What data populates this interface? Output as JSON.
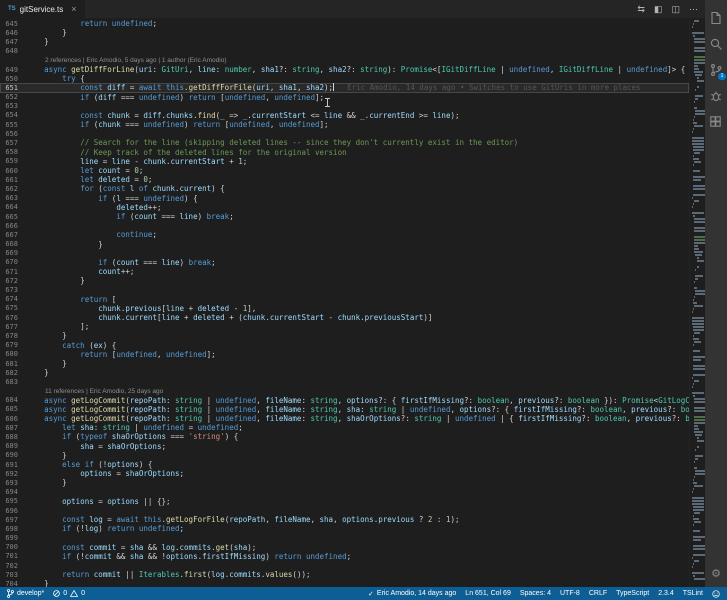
{
  "colors": {
    "accent": "#007acc",
    "status_bar_bg": "#0d5e94",
    "editor_bg": "#1e1e1e",
    "activity_bar_bg": "#333333",
    "keyword": "#569cd6",
    "type": "#4ec9b0",
    "function": "#dcdcaa",
    "variable": "#9cdcfe",
    "string": "#ce9178",
    "comment": "#6a9955",
    "number": "#b5cea8"
  },
  "tab_bar": {
    "active_tab": {
      "file_icon": "TS",
      "label": "gitService.ts",
      "close_glyph": "×"
    },
    "actions": [
      {
        "name": "open-changes",
        "glyph": "⇆"
      },
      {
        "name": "split-editor",
        "glyph": "◧"
      },
      {
        "name": "toggle-layout",
        "glyph": "◫"
      },
      {
        "name": "more-actions",
        "glyph": "⋯"
      }
    ]
  },
  "activity_bar": {
    "items": [
      {
        "name": "explorer"
      },
      {
        "name": "search"
      },
      {
        "name": "source-control",
        "badge": "1"
      },
      {
        "name": "debug"
      },
      {
        "name": "extensions"
      }
    ],
    "bottom": [
      {
        "name": "settings",
        "glyph": "⚙"
      }
    ]
  },
  "editor": {
    "lines": [
      {
        "n": 645,
        "code": "            return undefined;"
      },
      {
        "n": 646,
        "code": "        }"
      },
      {
        "n": 647,
        "code": "    }"
      },
      {
        "n": 648,
        "code": ""
      },
      {
        "lens": "2 references | Eric Amodio, 5 days ago | 1 author (Eric Amodio)"
      },
      {
        "n": 649,
        "code": "    async getDiffForLine(uri: GitUri, line: number, sha1?: string, sha2?: string): Promise<[IGitDiffLine | undefined, IGitDiffLine | undefined]> {"
      },
      {
        "n": 650,
        "code": "        try {"
      },
      {
        "n": 651,
        "code": "            const diff = await this.getDiffForFile(uri, sha1, sha2);",
        "current": true,
        "cursor": true,
        "blame": "Eric Amodio, 14 days ago • Switches to use GitUris in more places"
      },
      {
        "n": 652,
        "code": "            if (diff === undefined) return [undefined, undefined];"
      },
      {
        "n": 653,
        "code": ""
      },
      {
        "n": 654,
        "code": "            const chunk = diff.chunks.find(_ => _.currentStart <= line && _.currentEnd >= line);"
      },
      {
        "n": 655,
        "code": "            if (chunk === undefined) return [undefined, undefined];"
      },
      {
        "n": 656,
        "code": ""
      },
      {
        "n": 657,
        "code": "            // Search for the line (skipping deleted lines -- since they don't currently exist in the editor)"
      },
      {
        "n": 658,
        "code": "            // Keep track of the deleted lines for the original version"
      },
      {
        "n": 659,
        "code": "            line = line - chunk.currentStart + 1;"
      },
      {
        "n": 660,
        "code": "            let count = 0;"
      },
      {
        "n": 661,
        "code": "            let deleted = 0;"
      },
      {
        "n": 662,
        "code": "            for (const l of chunk.current) {"
      },
      {
        "n": 663,
        "code": "                if (l === undefined) {"
      },
      {
        "n": 664,
        "code": "                    deleted++;"
      },
      {
        "n": 665,
        "code": "                    if (count === line) break;"
      },
      {
        "n": 666,
        "code": ""
      },
      {
        "n": 667,
        "code": "                    continue;"
      },
      {
        "n": 668,
        "code": "                }"
      },
      {
        "n": 669,
        "code": ""
      },
      {
        "n": 670,
        "code": "                if (count === line) break;"
      },
      {
        "n": 671,
        "code": "                count++;"
      },
      {
        "n": 672,
        "code": "            }"
      },
      {
        "n": 673,
        "code": ""
      },
      {
        "n": 674,
        "code": "            return ["
      },
      {
        "n": 675,
        "code": "                chunk.previous[line + deleted - 1],"
      },
      {
        "n": 676,
        "code": "                chunk.current[line + deleted + (chunk.currentStart - chunk.previousStart)]"
      },
      {
        "n": 677,
        "code": "            ];"
      },
      {
        "n": 678,
        "code": "        }"
      },
      {
        "n": 679,
        "code": "        catch (ex) {"
      },
      {
        "n": 680,
        "code": "            return [undefined, undefined];"
      },
      {
        "n": 681,
        "code": "        }"
      },
      {
        "n": 682,
        "code": "    }"
      },
      {
        "n": 683,
        "code": ""
      },
      {
        "lens": "11 references | Eric Amodio, 25 days ago"
      },
      {
        "n": 684,
        "code": "    async getLogCommit(repoPath: string | undefined, fileName: string, options?: { firstIfMissing?: boolean, previous?: boolean }): Promise<GitLogCommit | undefined>;"
      },
      {
        "n": 685,
        "code": "    async getLogCommit(repoPath: string | undefined, fileName: string, sha: string | undefined, options?: { firstIfMissing?: boolean, previous?: boolean }): Promise<GitLogCommit | undefined>;"
      },
      {
        "n": 686,
        "code": "    async getLogCommit(repoPath: string | undefined, fileName: string, shaOrOptions?: string | undefined | { firstIfMissing?: boolean, previous?: boolean }, options?: { firstIfMissing?: boolean, previous?: boolean }): Promise<GitLogCommit | undefined> {"
      },
      {
        "n": 687,
        "code": "        let sha: string | undefined = undefined;"
      },
      {
        "n": 688,
        "code": "        if (typeof shaOrOptions === 'string') {"
      },
      {
        "n": 689,
        "code": "            sha = shaOrOptions;"
      },
      {
        "n": 690,
        "code": "        }"
      },
      {
        "n": 691,
        "code": "        else if (!options) {"
      },
      {
        "n": 692,
        "code": "            options = shaOrOptions;"
      },
      {
        "n": 693,
        "code": "        }"
      },
      {
        "n": 694,
        "code": ""
      },
      {
        "n": 695,
        "code": "        options = options || {};"
      },
      {
        "n": 696,
        "code": ""
      },
      {
        "n": 697,
        "code": "        const log = await this.getLogForFile(repoPath, fileName, sha, options.previous ? 2 : 1);"
      },
      {
        "n": 698,
        "code": "        if (!log) return undefined;"
      },
      {
        "n": 699,
        "code": ""
      },
      {
        "n": 700,
        "code": "        const commit = sha && log.commits.get(sha);"
      },
      {
        "n": 701,
        "code": "        if (!commit && sha && !options.firstIfMissing) return undefined;"
      },
      {
        "n": 702,
        "code": ""
      },
      {
        "n": 703,
        "code": "        return commit || Iterables.first(log.commits.values());"
      },
      {
        "n": 704,
        "code": "    }"
      }
    ]
  },
  "status_bar": {
    "left": {
      "branch": "develop*",
      "errors": "0",
      "warnings": "0"
    },
    "right": {
      "blame_icon": "✓",
      "blame": "Eric Amodio, 14 days ago",
      "cursor_position": "Ln 651, Col 69",
      "indentation": "Spaces: 4",
      "encoding": "UTF-8",
      "eol": "CRLF",
      "language": "TypeScript",
      "ts_version": "2.3.4",
      "linter": "TSLint"
    }
  }
}
